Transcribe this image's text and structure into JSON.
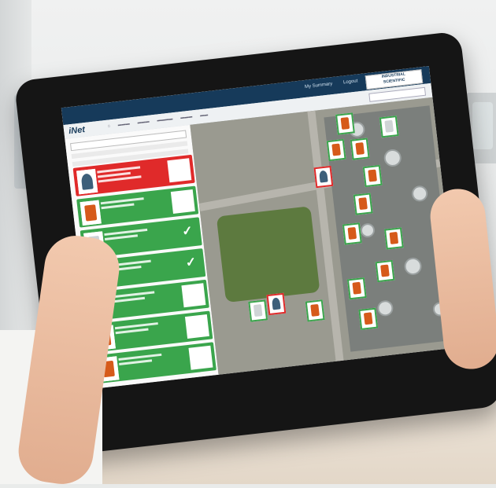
{
  "scene": {
    "description_free": true,
    "colors": {
      "tablet": "#151515",
      "topbar": "#163a5a",
      "alarm": "#e02a2a",
      "ok": "#3aa54c"
    }
  },
  "app": {
    "logo": "iNet",
    "topbar_links": [
      "My Summary",
      "Logout"
    ],
    "brand": [
      "INDUSTRIAL",
      "SCIENTIFIC"
    ]
  },
  "sidebar": {
    "cards": [
      {
        "status": "alarm",
        "icon": "worker-icon"
      },
      {
        "status": "ok",
        "icon": "gas-detector-icon"
      },
      {
        "status": "ok",
        "icon": "area-monitor-icon",
        "check": "✓"
      },
      {
        "status": "ok",
        "icon": "worker-icon",
        "check": "✓"
      },
      {
        "status": "ok",
        "icon": "gas-detector-icon"
      },
      {
        "status": "ok",
        "icon": "gas-detector-icon"
      },
      {
        "status": "ok",
        "icon": "gas-detector-icon"
      }
    ]
  },
  "map": {
    "marker_count": 15
  }
}
